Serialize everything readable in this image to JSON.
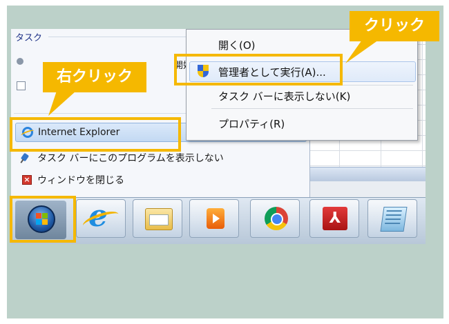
{
  "jump_list": {
    "section_title": "タスク",
    "partial_task_text": "開始",
    "pinned_item": "Internet Explorer",
    "unpin_label": "タスク バーにこのプログラムを表示しない",
    "close_label": "ウィンドウを閉じる"
  },
  "context_menu": {
    "items": [
      {
        "label": "開く(O)"
      },
      {
        "label": "管理者として実行(A)..."
      },
      {
        "label": "タスク バーに表示しない(K)"
      },
      {
        "label": "プロパティ(R)"
      }
    ]
  },
  "taskbar": {
    "ie_glyph": "e",
    "acrobat_glyph": "⅄",
    "apps": [
      "start-orb",
      "internet-explorer",
      "explorer-folder",
      "media-player",
      "chrome",
      "acrobat",
      "notepad"
    ]
  },
  "annotations": {
    "right_click": "右クリック",
    "click": "クリック",
    "highlight_color": "#f5b800"
  },
  "colors": {
    "frame_bg": "#bcd1c9",
    "accent": "#f5b800"
  }
}
